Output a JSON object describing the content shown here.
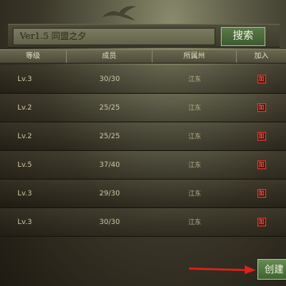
{
  "search": {
    "value": "Ver1.5 同盟之夕",
    "button_label": "搜索"
  },
  "table": {
    "headers": [
      "等级",
      "成员",
      "所属州",
      "加入"
    ],
    "rows": [
      {
        "level": "Lv.3",
        "members": "30/30",
        "province": "江东"
      },
      {
        "level": "Lv.2",
        "members": "25/25",
        "province": "江东"
      },
      {
        "level": "Lv.2",
        "members": "25/25",
        "province": "江东"
      },
      {
        "level": "Lv.5",
        "members": "37/40",
        "province": "江东"
      },
      {
        "level": "Lv.3",
        "members": "29/30",
        "province": "江东"
      },
      {
        "level": "Lv.3",
        "members": "30/30",
        "province": "江东"
      }
    ],
    "join_icon_glyph": "加"
  },
  "footer": {
    "create_button_label": "创建"
  },
  "colors": {
    "accent_green": "#4a6b3c",
    "arrow_red": "#e0201a",
    "join_icon_red": "#e03a2a"
  },
  "icons": {
    "bird": "bird-silhouette-icon",
    "join": "join-icon",
    "arrow": "arrow-right-icon"
  }
}
